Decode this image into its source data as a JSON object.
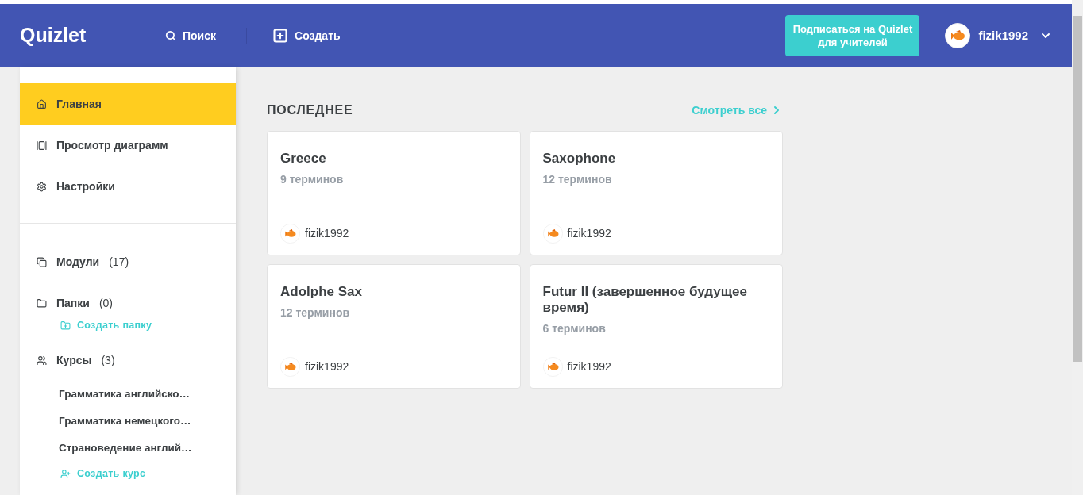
{
  "header": {
    "logo": "Quizlet",
    "search": "Поиск",
    "create": "Создать",
    "teacher_button": "Подписаться на Quizlet для учителей",
    "username": "fizik1992"
  },
  "sidebar": {
    "nav": [
      {
        "label": "Главная",
        "selected": true
      },
      {
        "label": "Просмотр диаграмм",
        "selected": false
      },
      {
        "label": "Настройки",
        "selected": false
      }
    ],
    "library": [
      {
        "label": "Модули",
        "count": "(17)"
      },
      {
        "label": "Папки",
        "count": "(0)",
        "action": "Создать папку"
      },
      {
        "label": "Курсы",
        "count": "(3)",
        "children": [
          "Грамматика английско…",
          "Грамматика немецкого…",
          "Страноведение англий…"
        ],
        "action": "Создать курс"
      }
    ]
  },
  "recent": {
    "title": "ПОСЛЕДНЕЕ",
    "see_all": "Смотреть все",
    "cards": [
      {
        "title": "Greece",
        "terms": "9 терминов",
        "author": "fizik1992"
      },
      {
        "title": "Saxophone",
        "terms": "12 терминов",
        "author": "fizik1992"
      },
      {
        "title": "Adolphe Sax",
        "terms": "12 терминов",
        "author": "fizik1992"
      },
      {
        "title": "Futur II (завершенное будущее время)",
        "terms": "6 терминов",
        "author": "fizik1992"
      }
    ]
  }
}
